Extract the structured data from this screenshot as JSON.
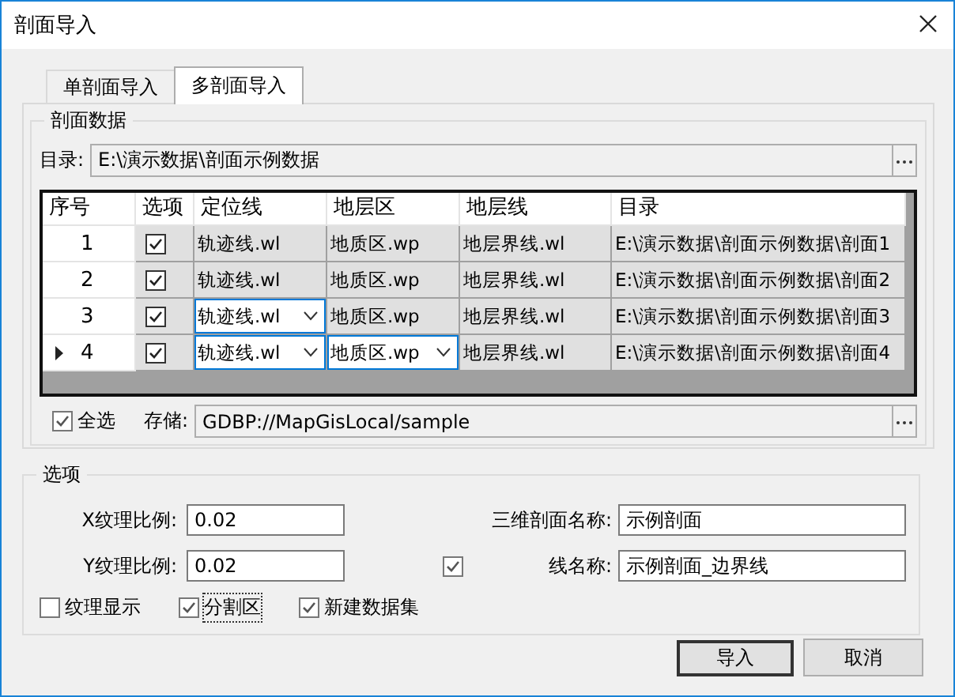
{
  "window": {
    "title": "剖面导入"
  },
  "tabs": [
    {
      "label": "单剖面导入",
      "selected": false
    },
    {
      "label": "多剖面导入",
      "selected": true
    }
  ],
  "data_group": {
    "title": "剖面数据",
    "directory": {
      "label": "目录:",
      "value": "E:\\演示数据\\剖面示例数据"
    }
  },
  "table": {
    "columns": [
      "序号",
      "选项",
      "定位线",
      "地层区",
      "地层线",
      "目录"
    ],
    "rows": [
      {
        "current": false,
        "cells": [
          {
            "text": "1",
            "kind": "number"
          },
          {
            "checked": true,
            "kind": "check"
          },
          {
            "text": "轨迹线.wl",
            "kind": "text"
          },
          {
            "text": "地质区.wp",
            "kind": "text"
          },
          {
            "text": "地层界线.wl",
            "kind": "text"
          },
          {
            "text": "E:\\演示数据\\剖面示例数据\\剖面1",
            "kind": "text"
          }
        ]
      },
      {
        "current": false,
        "cells": [
          {
            "text": "2",
            "kind": "number"
          },
          {
            "checked": true,
            "kind": "check"
          },
          {
            "text": "轨迹线.wl",
            "kind": "text"
          },
          {
            "text": "地质区.wp",
            "kind": "text"
          },
          {
            "text": "地层界线.wl",
            "kind": "text"
          },
          {
            "text": "E:\\演示数据\\剖面示例数据\\剖面2",
            "kind": "text"
          }
        ]
      },
      {
        "current": false,
        "cells": [
          {
            "text": "3",
            "kind": "number"
          },
          {
            "checked": true,
            "kind": "check"
          },
          {
            "text": "轨迹线.wl",
            "kind": "combo"
          },
          {
            "text": "地质区.wp",
            "kind": "text"
          },
          {
            "text": "地层界线.wl",
            "kind": "text"
          },
          {
            "text": "E:\\演示数据\\剖面示例数据\\剖面3",
            "kind": "text"
          }
        ]
      },
      {
        "current": true,
        "cells": [
          {
            "text": "4",
            "kind": "number"
          },
          {
            "checked": true,
            "kind": "check"
          },
          {
            "text": "轨迹线.wl",
            "kind": "combo"
          },
          {
            "text": "地质区.wp",
            "kind": "combo"
          },
          {
            "text": "地层界线.wl",
            "kind": "text"
          },
          {
            "text": "E:\\演示数据\\剖面示例数据\\剖面4",
            "kind": "text"
          }
        ]
      }
    ]
  },
  "select_all": {
    "label": "全选",
    "checked": true
  },
  "storage": {
    "label": "存储:",
    "value": "GDBP://MapGisLocal/sample"
  },
  "options": {
    "title": "选项",
    "x_scale": {
      "label": "X纹理比例:",
      "value": "0.02"
    },
    "y_scale": {
      "label": "Y纹理比例:",
      "value": "0.02"
    },
    "section_name": {
      "label": "三维剖面名称:",
      "value": "示例剖面"
    },
    "line_name": {
      "label": "线名称:",
      "value": "示例剖面_边界线",
      "checked": true
    },
    "checkboxes": [
      {
        "label": "纹理显示",
        "checked": false,
        "focused": false
      },
      {
        "label": "分割区",
        "checked": true,
        "focused": true
      },
      {
        "label": "新建数据集",
        "checked": true,
        "focused": false
      }
    ]
  },
  "buttons": [
    {
      "label": "导入",
      "default": true
    },
    {
      "label": "取消",
      "default": false
    }
  ]
}
